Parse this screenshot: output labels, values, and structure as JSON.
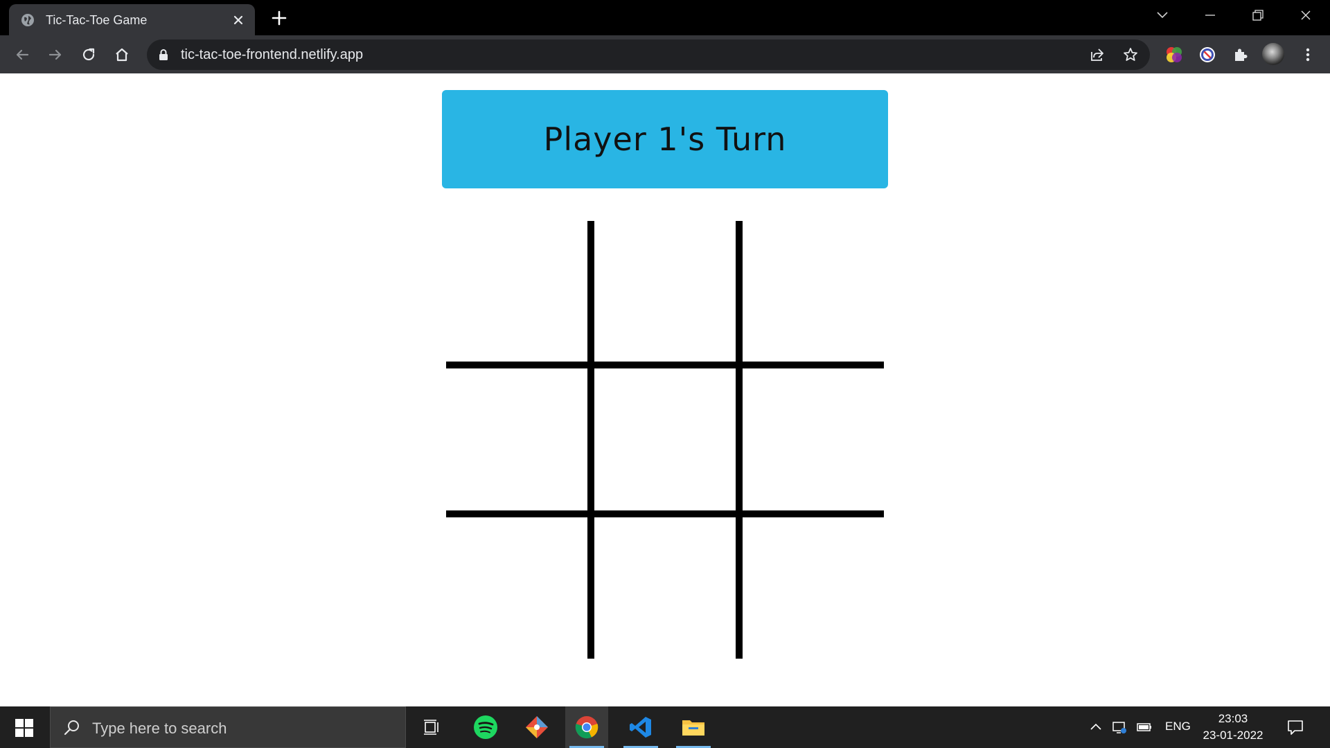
{
  "browser": {
    "tab": {
      "title": "Tic-Tac-Toe Game"
    },
    "address_bar": {
      "url": "tic-tac-toe-frontend.netlify.app"
    }
  },
  "game": {
    "turn_text": "Player 1's Turn",
    "banner_color": "#29b5e4",
    "board": [
      [
        "",
        "",
        ""
      ],
      [
        "",
        "",
        ""
      ],
      [
        "",
        "",
        ""
      ]
    ]
  },
  "taskbar": {
    "search_placeholder": "Type here to search",
    "apps": [
      "task-view-icon",
      "spotify-icon",
      "git-icon",
      "chrome-icon",
      "vscode-icon",
      "file-explorer-icon"
    ],
    "language": "ENG",
    "time": "23:03",
    "date": "23-01-2022"
  }
}
